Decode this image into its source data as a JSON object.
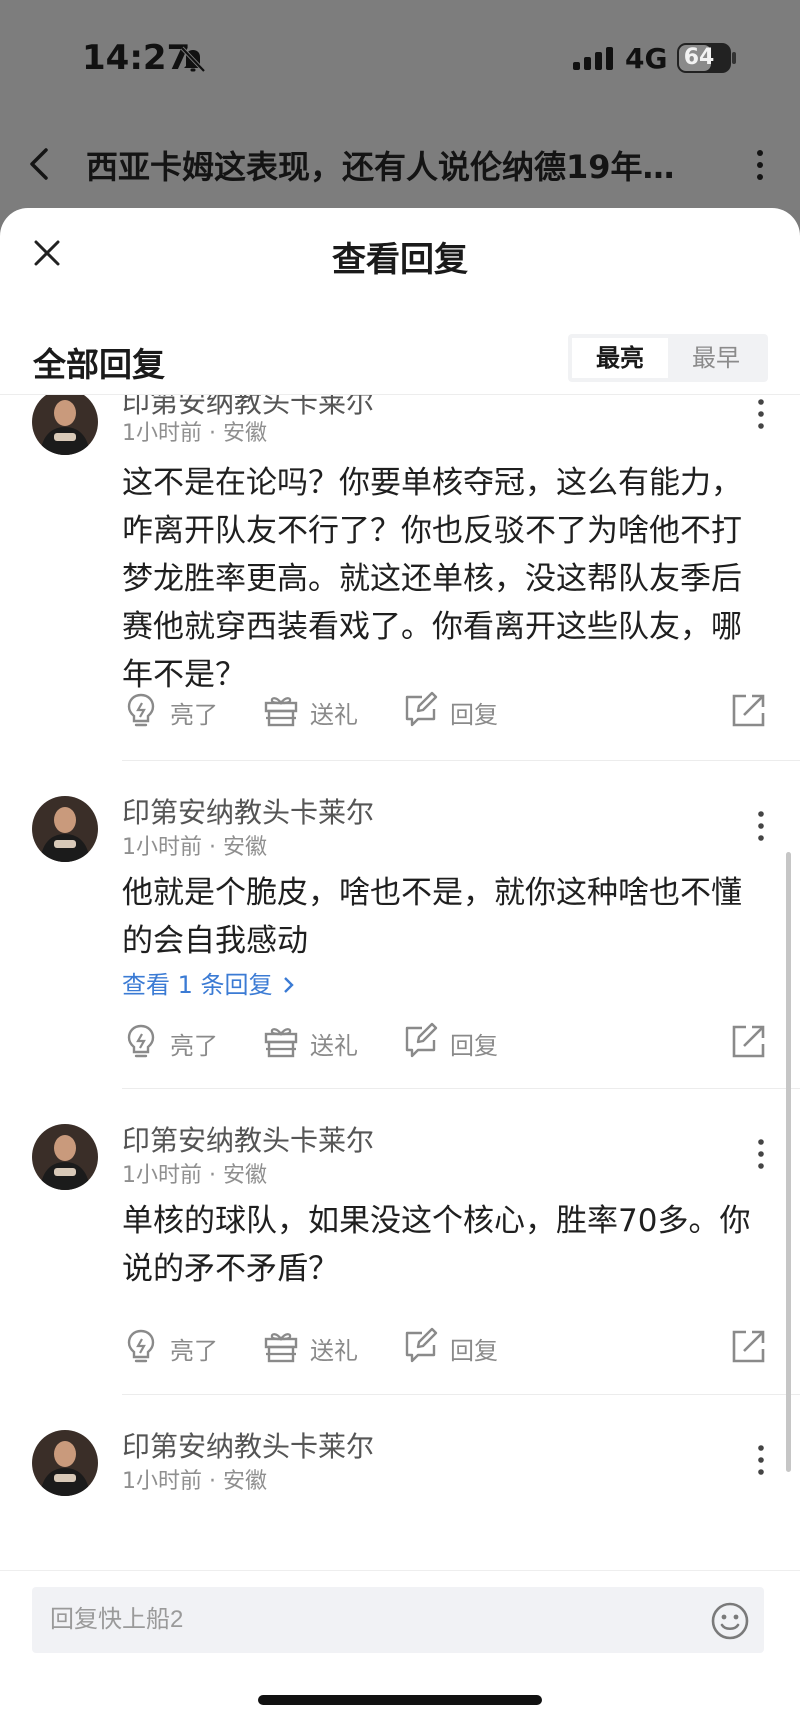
{
  "status_bar": {
    "time": "14:27",
    "network": "4G",
    "battery": "64",
    "battery_level": 0.64
  },
  "nav": {
    "title": "西亚卡姆这表现，还有人说伦纳德19年…"
  },
  "sheet": {
    "title": "查看回复"
  },
  "section": {
    "title": "全部回复",
    "sort_options": [
      "最亮",
      "最早"
    ],
    "sort_active": "最亮"
  },
  "comments": [
    {
      "user": "印第安纳教头卡莱尔",
      "meta": "1小时前 · 安徽",
      "text": "这不是在论吗？你要单核夺冠，这么有能力，咋离开队友不行了？你也反驳不了为啥他不打梦龙胜率更高。就这还单核，没这帮队友季后赛他就穿西装看戏了。你看离开这些队友，哪年不是？",
      "view_replies": ""
    },
    {
      "user": "印第安纳教头卡莱尔",
      "meta": "1小时前 · 安徽",
      "text": "他就是个脆皮，啥也不是，就你这种啥也不懂的会自我感动",
      "view_replies": "查看 1 条回复"
    },
    {
      "user": "印第安纳教头卡莱尔",
      "meta": "1小时前 · 安徽",
      "text": "单核的球队，如果没这个核心，胜率70多。你说的矛不矛盾？",
      "view_replies": ""
    },
    {
      "user": "印第安纳教头卡莱尔",
      "meta": "1小时前 · 安徽",
      "text": "",
      "view_replies": ""
    }
  ],
  "actions": {
    "light": "亮了",
    "gift": "送礼",
    "reply": "回复"
  },
  "reply_input": {
    "placeholder": "回复快上船2"
  },
  "icons": [
    "bell-muted-icon",
    "signal-icon",
    "battery-icon",
    "back-icon",
    "more-icon",
    "close-icon",
    "avatar",
    "lightbulb-icon",
    "gift-icon",
    "edit-icon",
    "share-icon",
    "chevron-right-icon",
    "emoji-icon"
  ],
  "colors": {
    "link": "#3b7bd4",
    "muted": "#8a8a8a",
    "overlay": "#7d7d7d"
  }
}
